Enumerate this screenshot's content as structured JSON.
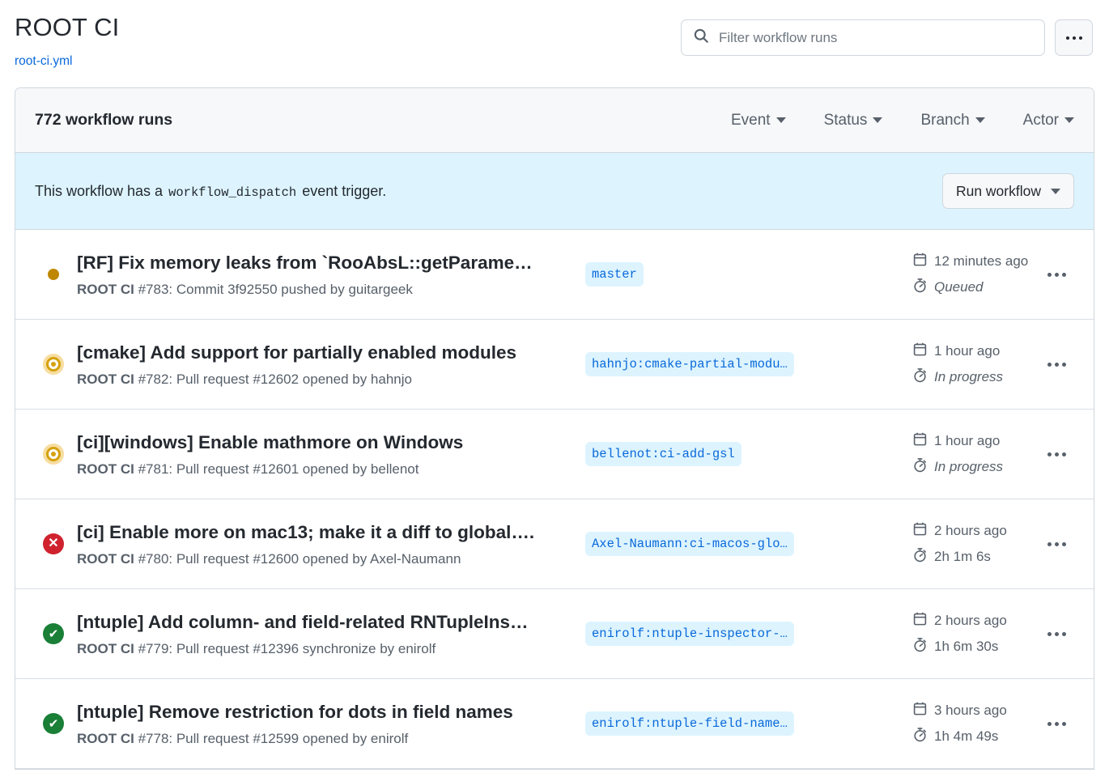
{
  "header": {
    "title": "ROOT CI",
    "workflow_file": "root-ci.yml",
    "search_placeholder": "Filter workflow runs",
    "search_value": "",
    "search_icon": "search-icon",
    "overflow_icon": "kebab-horizontal-icon"
  },
  "runs_header": {
    "count_label": "772 workflow runs",
    "filters": [
      {
        "label": "Event"
      },
      {
        "label": "Status"
      },
      {
        "label": "Branch"
      },
      {
        "label": "Actor"
      }
    ]
  },
  "dispatch_banner": {
    "text_before": "This workflow has a",
    "code": "workflow_dispatch",
    "text_after": "event trigger.",
    "button_label": "Run workflow",
    "background": "#ddf4ff"
  },
  "status_colors": {
    "queued": "#bf8700",
    "in_progress": "#d4a20e",
    "failure": "#cf222e",
    "success": "#1a7f37",
    "link": "#0969da"
  },
  "runs": [
    {
      "status": "queued",
      "status_icon": "queued-dot-icon",
      "title": "[RF] Fix memory leaks from `RooAbsL::getParame…",
      "workflow_name": "ROOT CI",
      "subtitle": "#783: Commit 3f92550 pushed by guitargeek",
      "branch": "master",
      "time_ago": "12 minutes ago",
      "duration": "Queued",
      "duration_running": true
    },
    {
      "status": "in_progress",
      "status_icon": "in-progress-ring-icon",
      "title": "[cmake] Add support for partially enabled modules",
      "workflow_name": "ROOT CI",
      "subtitle": "#782: Pull request #12602 opened by hahnjo",
      "branch": "hahnjo:cmake-partial-modu…",
      "time_ago": "1 hour ago",
      "duration": "In progress",
      "duration_running": true
    },
    {
      "status": "in_progress",
      "status_icon": "in-progress-ring-icon",
      "title": "[ci][windows] Enable mathmore on Windows",
      "workflow_name": "ROOT CI",
      "subtitle": "#781: Pull request #12601 opened by bellenot",
      "branch": "bellenot:ci-add-gsl",
      "time_ago": "1 hour ago",
      "duration": "In progress",
      "duration_running": true
    },
    {
      "status": "failure",
      "status_icon": "failure-x-icon",
      "title": "[ci] Enable more on mac13; make it a diff to global….",
      "workflow_name": "ROOT CI",
      "subtitle": "#780: Pull request #12600 opened by Axel-Naumann",
      "branch": "Axel-Naumann:ci-macos-glo…",
      "time_ago": "2 hours ago",
      "duration": "2h 1m 6s",
      "duration_running": false
    },
    {
      "status": "success",
      "status_icon": "success-check-icon",
      "title": "[ntuple] Add column- and field-related RNTupleIns…",
      "workflow_name": "ROOT CI",
      "subtitle": "#779: Pull request #12396 synchronize by enirolf",
      "branch": "enirolf:ntuple-inspector-…",
      "time_ago": "2 hours ago",
      "duration": "1h 6m 30s",
      "duration_running": false
    },
    {
      "status": "success",
      "status_icon": "success-check-icon",
      "title": "[ntuple] Remove restriction for dots in field names",
      "workflow_name": "ROOT CI",
      "subtitle": "#778: Pull request #12599 opened by enirolf",
      "branch": "enirolf:ntuple-field-name…",
      "time_ago": "3 hours ago",
      "duration": "1h 4m 49s",
      "duration_running": false
    }
  ],
  "icons": {
    "calendar": "calendar-icon",
    "stopwatch": "stopwatch-icon",
    "row_menu": "kebab-horizontal-icon"
  }
}
